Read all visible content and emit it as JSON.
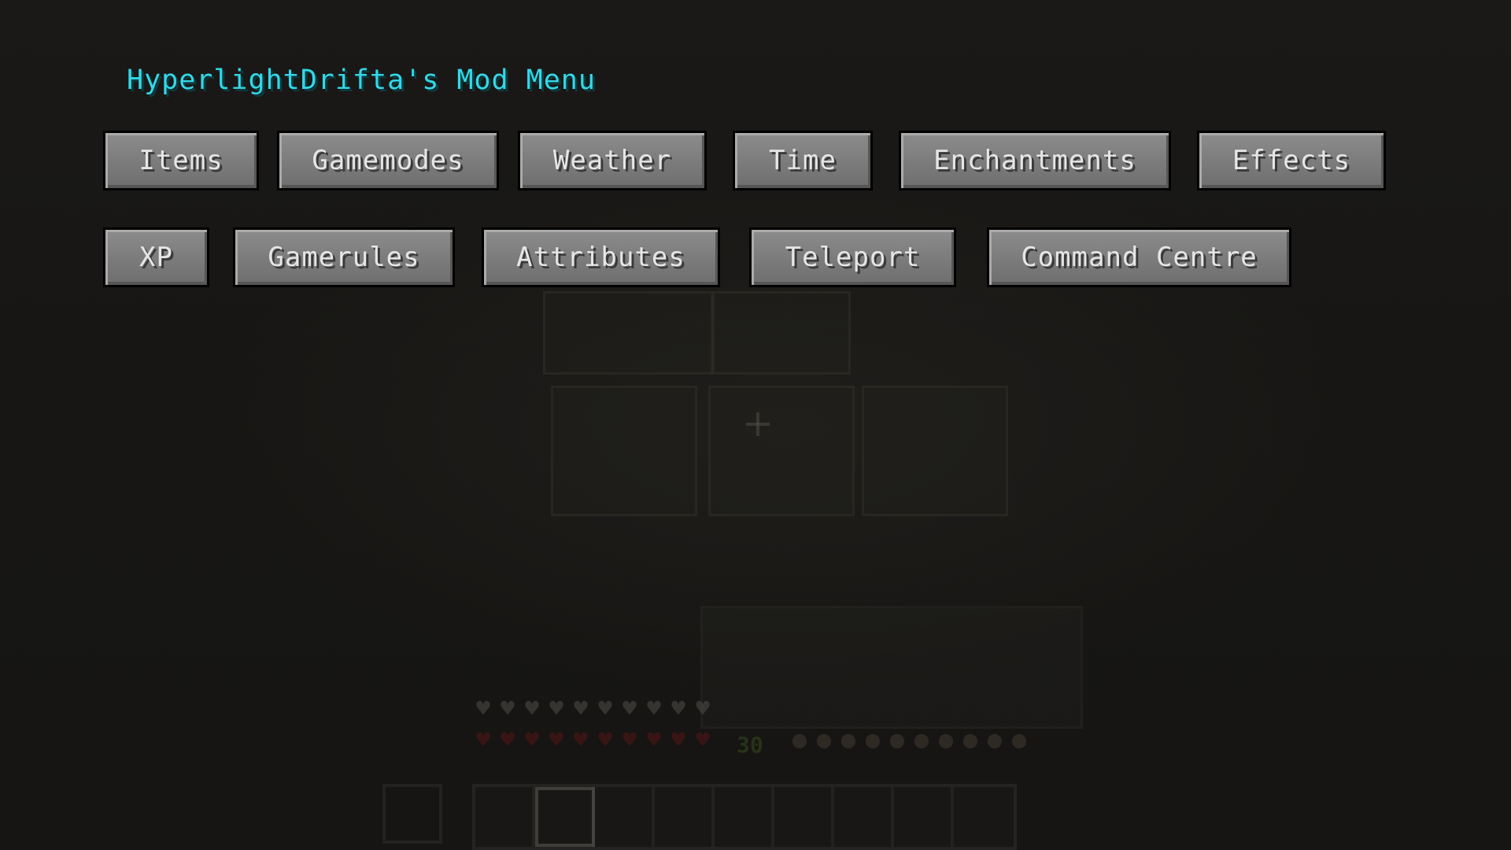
{
  "menu": {
    "title": "HyperlightDrifta's Mod Menu",
    "title_color": "#33d8e8",
    "rows": [
      [
        "Items",
        "Gamemodes",
        "Weather",
        "Time",
        "Enchantments",
        "Effects"
      ],
      [
        "XP",
        "Gamerules",
        "Attributes",
        "Teleport",
        "Command Centre"
      ]
    ]
  },
  "hud": {
    "xp_level": "30",
    "armor_points_icons": 10,
    "health_icons": 10,
    "food_icons": 10,
    "hotbar_slots": 9,
    "selected_slot": 2
  },
  "colors": {
    "background": "#151413",
    "button_face": "#7b7b7b",
    "button_text": "#e6e6e6"
  }
}
